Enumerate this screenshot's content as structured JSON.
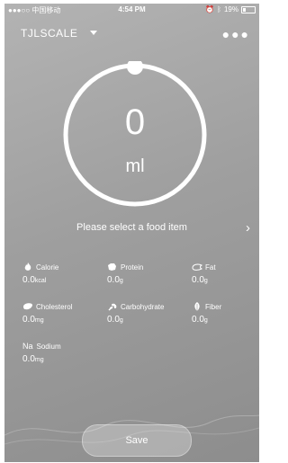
{
  "status_bar": {
    "carrier": "●●●○○ 中国移动",
    "time": "4:54 PM",
    "battery": "19%"
  },
  "header": {
    "device_name": "TJLSCALE"
  },
  "dial": {
    "value": "0",
    "unit": "ml"
  },
  "food_select": {
    "prompt": "Please select a food item"
  },
  "nutrients": {
    "calorie": {
      "label": "Calorie",
      "value": "0.0",
      "unit": "kcal"
    },
    "protein": {
      "label": "Protein",
      "value": "0.0",
      "unit": "g"
    },
    "fat": {
      "label": "Fat",
      "value": "0.0",
      "unit": "g"
    },
    "cholesterol": {
      "label": "Cholesterol",
      "value": "0.0",
      "unit": "mg"
    },
    "carbohydrate": {
      "label": "Carbohydrate",
      "value": "0.0",
      "unit": "g"
    },
    "fiber": {
      "label": "Fiber",
      "value": "0.0",
      "unit": "g"
    },
    "sodium": {
      "label": "Sodium",
      "icon_text": "Na",
      "value": "0.0",
      "unit": "mg"
    }
  },
  "actions": {
    "save_label": "Save"
  },
  "colors": {
    "background": "#9f9f9f",
    "foreground": "#ffffff"
  }
}
